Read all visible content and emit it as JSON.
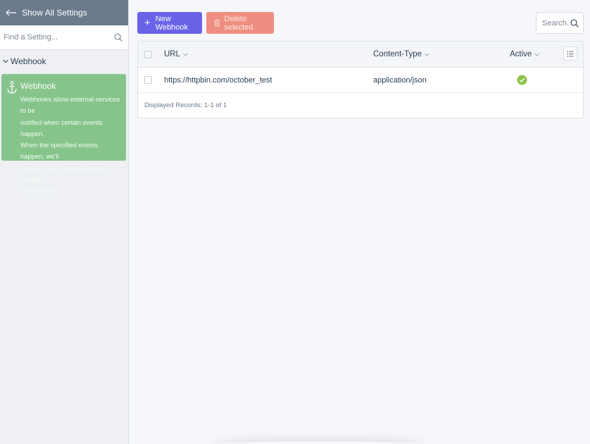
{
  "sidebar": {
    "back_label": "Show All Settings",
    "search_placeholder": "Find a Setting...",
    "section_label": "Webhook",
    "card": {
      "title": "Webhook",
      "lines": [
        "Webhooks allow external services to be",
        "notified when certain events happen.",
        "When the specified events happen, we'll",
        "send a POST request to each of the URLs",
        "you provide."
      ],
      "icon": "anchor-icon"
    }
  },
  "toolbar": {
    "new_label": "New Webhook",
    "delete_label": "Delete selected",
    "search_placeholder": "Search..."
  },
  "table": {
    "columns": [
      "URL",
      "Content-Type",
      "Active"
    ],
    "rows": [
      {
        "url": "https://httpbin.com/october_test",
        "content_type": "application/json",
        "active": true
      }
    ],
    "footer": "Displayed Records: 1-1 of 1"
  },
  "colors": {
    "accent": "#6a63e8",
    "danger": "#ef8e80",
    "sidebar_header": "#6c7a8e",
    "card": "#86c48c",
    "active_check": "#8bc34a"
  }
}
